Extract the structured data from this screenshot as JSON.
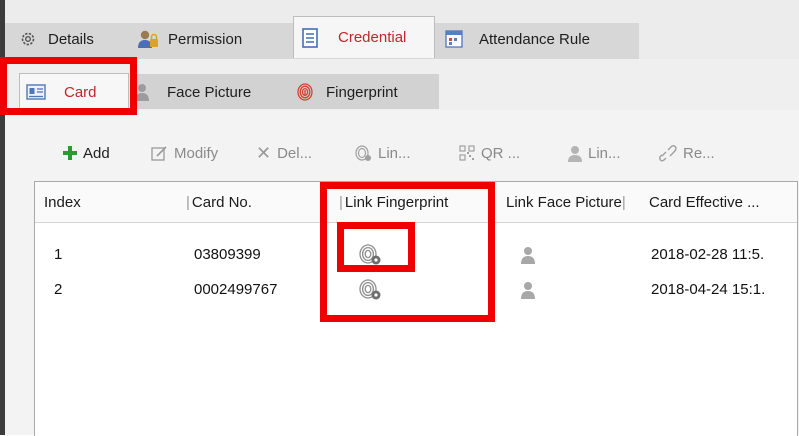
{
  "top_tabs": [
    {
      "label": "Details",
      "icon": "gear-icon"
    },
    {
      "label": "Permission",
      "icon": "user-lock-icon"
    },
    {
      "label": "Credential",
      "icon": "credential-doc-icon",
      "active": true
    },
    {
      "label": "Attendance Rule",
      "icon": "attendance-icon"
    }
  ],
  "sub_tabs": [
    {
      "label": "Card",
      "icon": "card-icon",
      "active": true
    },
    {
      "label": "Face Picture",
      "icon": "person-icon"
    },
    {
      "label": "Fingerprint",
      "icon": "fingerprint-icon"
    }
  ],
  "toolbar": {
    "add": "Add",
    "modify": "Modify",
    "delete": "Del...",
    "link_fingerprint": "Lin...",
    "qr": "QR ...",
    "link_face": "Lin...",
    "remove": "Re..."
  },
  "table": {
    "columns": [
      "Index",
      "Card No.",
      "Link Fingerprint",
      "Link Face Picture",
      "Card Effective ..."
    ],
    "rows": [
      {
        "index": "1",
        "card_no": "03809399",
        "effective": "2018-02-28 11:5."
      },
      {
        "index": "2",
        "card_no": "0002499767",
        "effective": "2018-04-24 15:1."
      }
    ]
  },
  "colors": {
    "accent_red": "#c0262c",
    "highlight_red": "#f00000",
    "add_green": "#2e9a2e"
  }
}
